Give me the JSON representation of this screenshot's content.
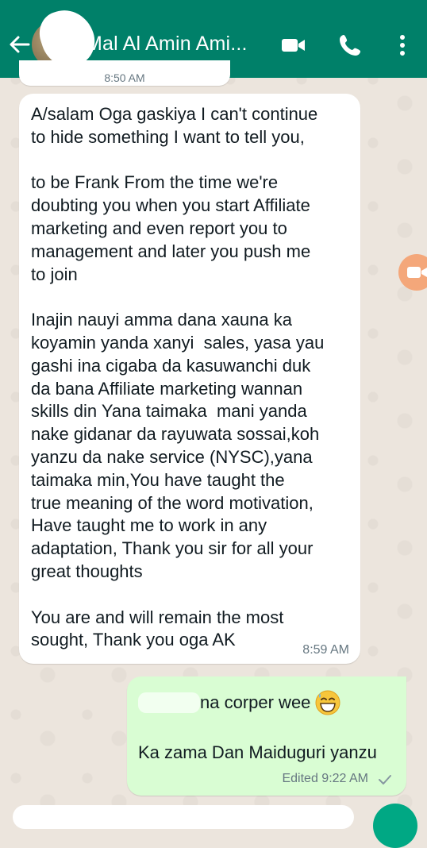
{
  "header": {
    "contact_name": "Mal Al Amin Ami...",
    "icons": [
      "back-arrow-icon",
      "video-call-icon",
      "phone-icon",
      "more-options-icon"
    ],
    "color": "#008069"
  },
  "chat": {
    "date_chip": "8:50 AM",
    "incoming": {
      "text": "A/salam Oga gaskiya I can't continue\nto hide something I want to tell you,\n\nto be Frank From the time we're\ndoubting you when you start Affiliate\nmarketing and even report you to\nmanagement and later you push me\nto join\n\nInajin nauyi amma dana xauna ka\nkoyamin yanda xanyi  sales, yasa yau\ngashi ina cigaba da kasuwanchi duk\nda bana Affiliate marketing wannan\nskills din Yana taimaka  mani yanda\nnake gidanar da rayuwata sossai,koh\nyanzu da nake service (NYSC),yana\ntaimaka min,You have taught the\ntrue meaning of the word motivation,\nHave taught me to work in any\nadaptation, Thank you sir for all your\ngreat thoughts\n\nYou are and will remain the most\nsought, Thank you oga AK",
      "time": "8:59 AM"
    },
    "outgoing": {
      "line1": "na corper wee",
      "emoji": "grinning-sweat-emoji",
      "line2": "Ka zama Dan Maiduguri yanzu",
      "status": "Edited 9:22 AM",
      "tick_icon": "single-check-icon"
    }
  },
  "colors": {
    "chat_bg": "#ece5dd",
    "incoming_bubble": "#ffffff",
    "outgoing_bubble": "#d9fdd3",
    "accent": "#00a884"
  }
}
